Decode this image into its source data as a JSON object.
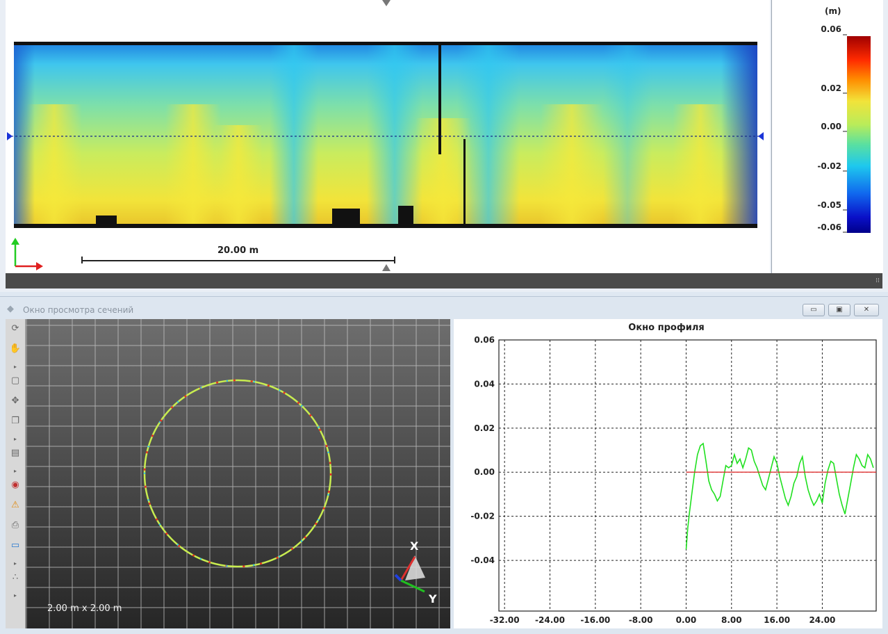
{
  "deviation_map": {
    "scale_bar_label": "20.00 m"
  },
  "legend": {
    "unit": "(m)",
    "ticks": [
      "0.06",
      "0.02",
      "0.00",
      "-0.02",
      "-0.05",
      "-0.06"
    ]
  },
  "section_window": {
    "title": "Окно просмотра сечений",
    "buttons": {
      "minimize": "▭",
      "maximize": "▣",
      "close": "✕"
    },
    "grid_size_label": "2.00 m x 2.00 m",
    "axis_x_label": "X",
    "axis_y_label": "Y",
    "toolbar_icons": [
      "rotate-icon",
      "hand-icon",
      "arrow-icon",
      "page-icon",
      "move-icon",
      "copy-icon",
      "arrow-icon",
      "doc-icon",
      "arrow-icon",
      "eye-icon",
      "warning-icon",
      "print-icon",
      "image-icon",
      "arrow-icon",
      "dots-icon",
      "arrow-icon"
    ]
  },
  "profile": {
    "title": "Окно профиля"
  },
  "chart_data": {
    "type": "line",
    "title": "Окно профиля",
    "xlabel": "",
    "ylabel": "",
    "x_ticks": [
      "-32.00",
      "-24.00",
      "-16.00",
      "-8.00",
      "0.00",
      "8.00",
      "16.00",
      "24.00"
    ],
    "y_ticks": [
      "0.06",
      "0.04",
      "0.02",
      "0.00",
      "-0.02",
      "-0.04"
    ],
    "xlim": [
      -33,
      33.5
    ],
    "ylim": [
      -0.063,
      0.06
    ],
    "grid": true,
    "series": [
      {
        "color": "#1fe01f",
        "x": [
          0,
          0.3,
          0.6,
          1.0,
          1.5,
          2.0,
          2.5,
          3.0,
          3.5,
          4.0,
          4.5,
          5.0,
          5.5,
          6.0,
          6.5,
          7.0,
          7.5,
          8.0,
          8.5,
          9.0,
          9.5,
          10.0,
          10.5,
          11.0,
          11.5,
          12.0,
          12.5,
          13.0,
          13.5,
          14.0,
          14.5,
          15.0,
          15.5,
          16.0,
          16.5,
          17.0,
          17.5,
          18.0,
          18.5,
          19.0,
          19.5,
          20.0,
          20.5,
          21.0,
          21.5,
          22.0,
          22.5,
          23.0,
          23.5,
          24.0,
          24.5,
          25.0,
          25.5,
          26.0,
          26.5,
          27.0,
          27.5,
          28.0,
          28.5,
          29.0,
          29.5,
          30.0,
          30.5,
          31.0,
          31.5,
          32.0,
          32.5,
          33.0
        ],
        "y": [
          -0.035,
          -0.025,
          -0.018,
          -0.01,
          0.0,
          0.008,
          0.012,
          0.013,
          0.005,
          -0.004,
          -0.008,
          -0.01,
          -0.013,
          -0.011,
          -0.004,
          0.003,
          0.002,
          0.003,
          0.008,
          0.004,
          0.006,
          0.002,
          0.006,
          0.011,
          0.01,
          0.005,
          0.002,
          -0.002,
          -0.006,
          -0.008,
          -0.003,
          0.002,
          0.007,
          0.004,
          -0.002,
          -0.007,
          -0.012,
          -0.015,
          -0.011,
          -0.005,
          -0.002,
          0.004,
          0.007,
          -0.002,
          -0.008,
          -0.012,
          -0.015,
          -0.013,
          -0.01,
          -0.014,
          -0.005,
          0.001,
          0.005,
          0.004,
          -0.003,
          -0.01,
          -0.015,
          -0.019,
          -0.012,
          -0.005,
          0.002,
          0.008,
          0.006,
          0.003,
          0.002,
          0.008,
          0.006,
          0.002
        ]
      },
      {
        "color": "#e03030",
        "x": [
          0,
          33.5
        ],
        "y": [
          0,
          0
        ]
      }
    ]
  }
}
